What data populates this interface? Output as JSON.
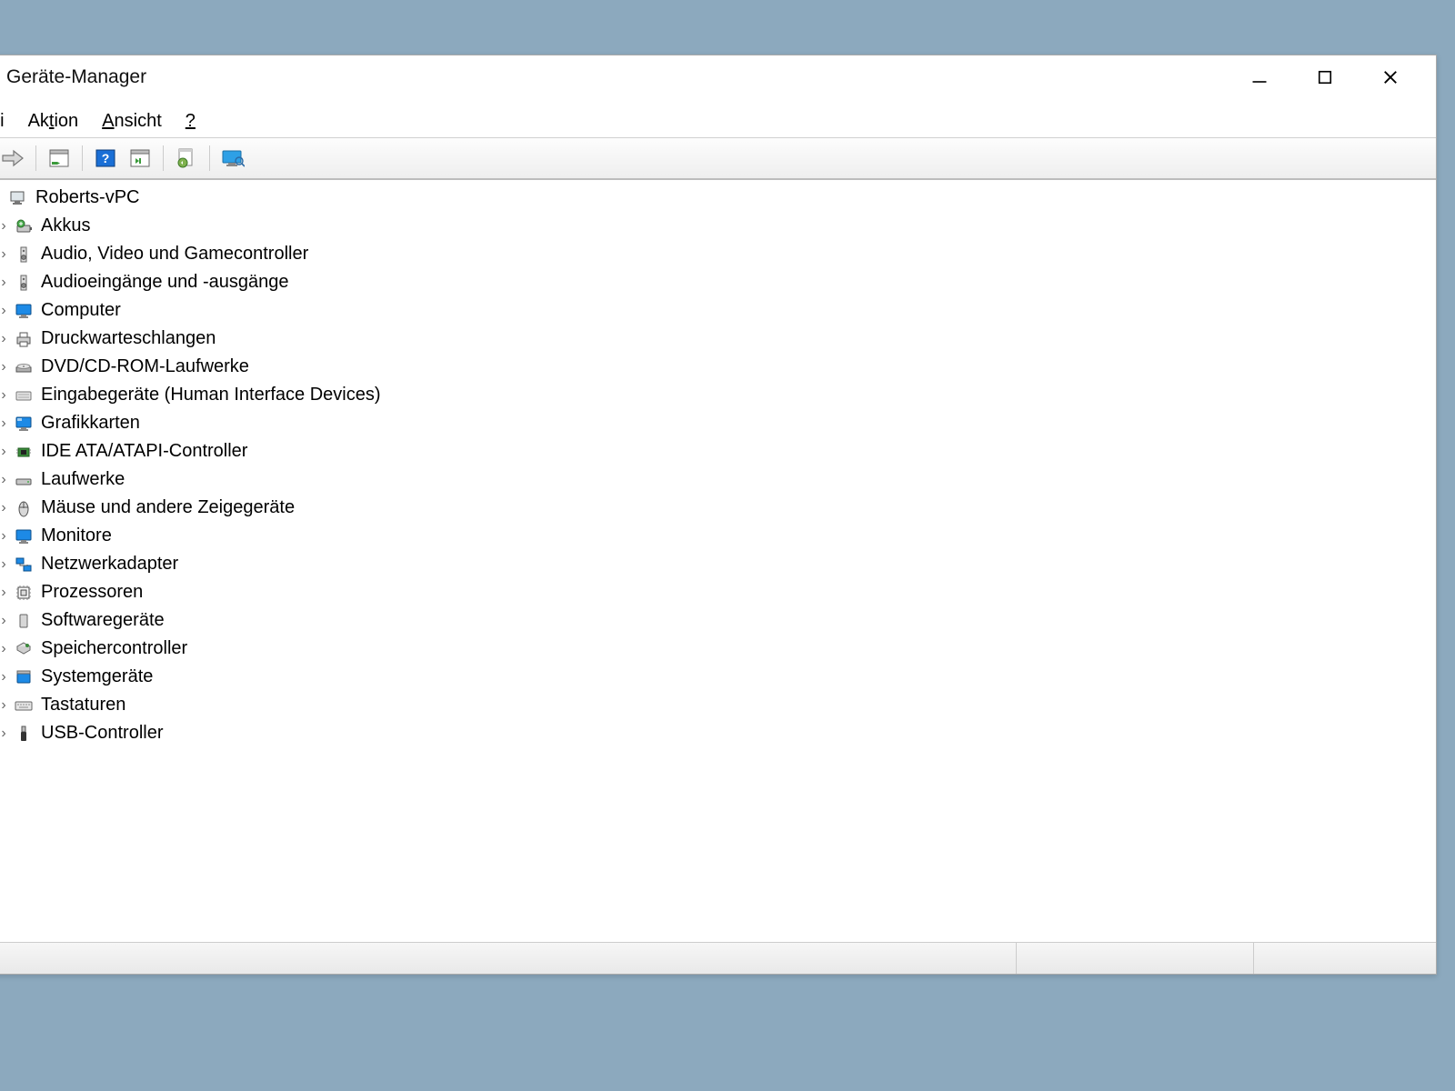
{
  "window": {
    "title": "Geräte-Manager"
  },
  "menu": {
    "file": "ei",
    "action": "Aktion",
    "action_u": "t",
    "view": "Ansicht",
    "view_u": "A",
    "help": "?"
  },
  "tree": {
    "root": "Roberts-vPC",
    "items": [
      {
        "icon": "battery",
        "label": "Akkus"
      },
      {
        "icon": "speaker",
        "label": "Audio, Video und Gamecontroller"
      },
      {
        "icon": "speaker",
        "label": "Audioeingänge und -ausgänge"
      },
      {
        "icon": "monitor-blue",
        "label": "Computer"
      },
      {
        "icon": "printer",
        "label": "Druckwarteschlangen"
      },
      {
        "icon": "disc",
        "label": "DVD/CD-ROM-Laufwerke"
      },
      {
        "icon": "hid",
        "label": "Eingabegeräte (Human Interface Devices)"
      },
      {
        "icon": "gpu",
        "label": "Grafikkarten"
      },
      {
        "icon": "chip",
        "label": "IDE ATA/ATAPI-Controller"
      },
      {
        "icon": "drive",
        "label": "Laufwerke"
      },
      {
        "icon": "mouse",
        "label": "Mäuse und andere Zeigegeräte"
      },
      {
        "icon": "monitor-blue",
        "label": "Monitore"
      },
      {
        "icon": "network",
        "label": "Netzwerkadapter"
      },
      {
        "icon": "cpu",
        "label": "Prozessoren"
      },
      {
        "icon": "box",
        "label": "Softwaregeräte"
      },
      {
        "icon": "storage",
        "label": "Speichercontroller"
      },
      {
        "icon": "system",
        "label": "Systemgeräte"
      },
      {
        "icon": "keyboard",
        "label": "Tastaturen"
      },
      {
        "icon": "usb",
        "label": "USB-Controller"
      }
    ]
  }
}
